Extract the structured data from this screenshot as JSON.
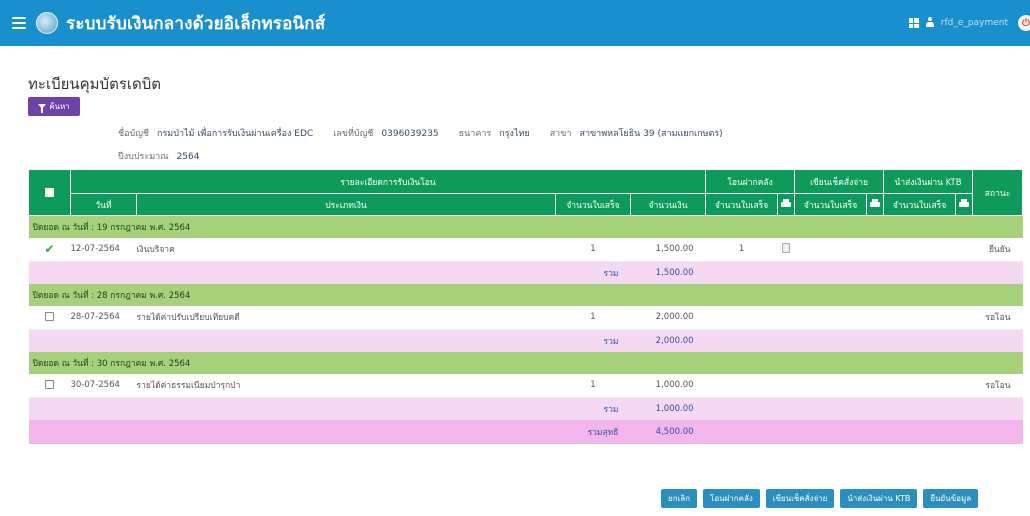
{
  "header": {
    "app_title": "ระบบรับเงินกลางด้วยอิเล็กทรอนิกส์",
    "username": "rfd_e_payment",
    "logout_glyph": "⏻"
  },
  "page": {
    "title": "ทะเบียนคุมบัตรเดบิต",
    "search_label": "ค้นหา"
  },
  "info": {
    "account_name_label": "ชื่อบัญชี",
    "account_name": "กรมป่าไม้ เพื่อการรับเงินผ่านเครื่อง EDC",
    "account_no_label": "เลขที่บัญชี",
    "account_no": "0396039235",
    "bank_label": "ธนาคาร",
    "bank": "กรุงไทย",
    "branch_label": "สาขา",
    "branch": "สาขาพหลโยธิน 39 (สามแยกเกษตร)",
    "fiscal_year_label": "ปีงบประมาณ",
    "fiscal_year": "2564"
  },
  "table": {
    "header": {
      "details_group": "รายละเอียดการรับเงินโอน",
      "transfer_treasury": "โอนฝากคลัง",
      "write_cheque": "เขียนเช็คสั่งจ่าย",
      "deposit_ktb": "นำส่งเงินผ่าน KTB",
      "status": "สถานะ",
      "date": "วันที่",
      "money_type": "ประเภทเงิน",
      "receipt_count": "จำนวนใบเสร็จ",
      "amount": "จำนวนเงิน",
      "receipt_count_2": "จำนวนใบเสร็จ",
      "receipt_count_3": "จำนวนใบเสร็จ",
      "receipt_count_4": "จำนวนใบเสร็จ"
    },
    "groups": [
      {
        "title": "ปิดยอด ณ วันที่ : 19 กรกฎาคม พ.ศ. 2564",
        "row": {
          "selected": true,
          "date": "12-07-2564",
          "money_type": "เงินบริจาค",
          "receipts": "1",
          "amount": "1,500.00",
          "treasury_receipts": "1",
          "status": "ยืนยัน"
        },
        "total_label": "รวม",
        "total": "1,500.00"
      },
      {
        "title": "ปิดยอด ณ วันที่ : 28 กรกฎาคม พ.ศ. 2564",
        "row": {
          "selected": false,
          "date": "28-07-2564",
          "money_type": "รายได้ค่าปรับเปรียบเทียบคดี",
          "receipts": "1",
          "amount": "2,000.00",
          "treasury_receipts": "",
          "status": "รอโอน"
        },
        "total_label": "รวม",
        "total": "2,000.00"
      },
      {
        "title": "ปิดยอด ณ วันที่ : 30 กรกฎาคม พ.ศ. 2564",
        "row": {
          "selected": false,
          "date": "30-07-2564",
          "money_type": "รายได้ค่าธรรมเนียมป่ารุกป่า",
          "receipts": "1",
          "amount": "1,000.00",
          "treasury_receipts": "",
          "status": "รอโอน"
        },
        "total_label": "รวม",
        "total": "1,000.00"
      }
    ],
    "net_total_label": "รวมสุทธิ",
    "net_total": "4,500.00"
  },
  "actions": {
    "cancel": "ยกเลิก",
    "transfer": "โอนฝากคลัง",
    "cheque": "เขียนเช็คสั่งจ่าย",
    "ktb": "นำส่งเงินผ่าน KTB",
    "confirm": "ยืนยันข้อมูล"
  },
  "colors": {
    "topbar": "#1a8fcd",
    "table_header": "#0e9a5a",
    "group_row": "#a6d17a",
    "sum_row": "#f5d9f3",
    "net_row": "#f3b6ec",
    "search_button": "#6f42a8",
    "action_button": "#2a8fbd"
  },
  "icons": [
    "hamburger-icon",
    "logo-icon",
    "grid-icon",
    "user-icon",
    "logout-icon",
    "filter-icon",
    "printer-icon",
    "check-icon",
    "document-icon"
  ]
}
